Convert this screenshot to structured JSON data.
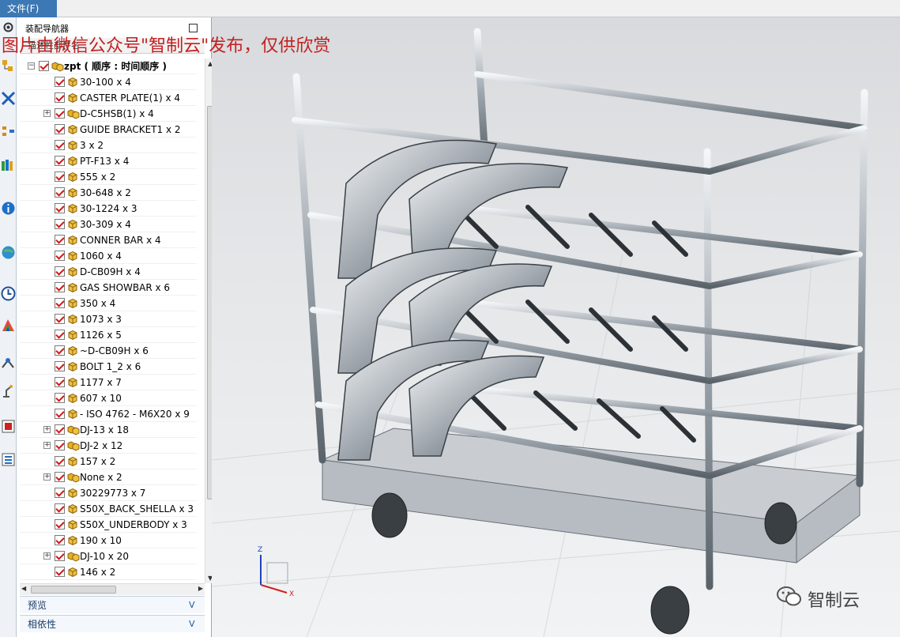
{
  "menubar": {
    "file_menu": "文件(F)"
  },
  "watermark": {
    "text": "图片由微信公众号\"智制云\"发布，仅供欣赏"
  },
  "navigator": {
    "title": "装配导航器",
    "column_header": "描述性部件名",
    "root": {
      "label": "zpt ( 顺序 : 时间顺序 )"
    },
    "items": [
      {
        "label": "30-100 x 4",
        "expandable": false
      },
      {
        "label": "CASTER PLATE(1) x 4",
        "expandable": false
      },
      {
        "label": "D-C5HSB(1) x 4",
        "expandable": true
      },
      {
        "label": "GUIDE BRACKET1 x 2",
        "expandable": false
      },
      {
        "label": "3 x 2",
        "expandable": false
      },
      {
        "label": "PT-F13 x 4",
        "expandable": false
      },
      {
        "label": "555 x 2",
        "expandable": false
      },
      {
        "label": "30-648 x 2",
        "expandable": false
      },
      {
        "label": "30-1224 x 3",
        "expandable": false
      },
      {
        "label": "30-309 x 4",
        "expandable": false
      },
      {
        "label": "CONNER BAR x 4",
        "expandable": false
      },
      {
        "label": "1060 x 4",
        "expandable": false
      },
      {
        "label": "D-CB09H x 4",
        "expandable": false
      },
      {
        "label": "GAS SHOWBAR x 6",
        "expandable": false
      },
      {
        "label": "350 x 4",
        "expandable": false
      },
      {
        "label": "1073 x 3",
        "expandable": false
      },
      {
        "label": "1126 x 5",
        "expandable": false
      },
      {
        "label": "~D-CB09H x 6",
        "expandable": false
      },
      {
        "label": "BOLT 1_2 x 6",
        "expandable": false
      },
      {
        "label": "1177 x 7",
        "expandable": false
      },
      {
        "label": "607 x 10",
        "expandable": false
      },
      {
        "label": "- ISO 4762 - M6X20 x 9",
        "expandable": false
      },
      {
        "label": "DJ-13 x 18",
        "expandable": true
      },
      {
        "label": "DJ-2 x 12",
        "expandable": true
      },
      {
        "label": "157 x 2",
        "expandable": false
      },
      {
        "label": "None x 2",
        "expandable": true
      },
      {
        "label": "30229773 x 7",
        "expandable": false
      },
      {
        "label": "S50X_BACK_SHELLA x 3",
        "expandable": false
      },
      {
        "label": "S50X_UNDERBODY x 3",
        "expandable": false
      },
      {
        "label": "190 x 10",
        "expandable": false
      },
      {
        "label": "DJ-10 x 20",
        "expandable": true
      },
      {
        "label": "146 x 2",
        "expandable": false
      }
    ],
    "sections": {
      "preview": "预览",
      "dependencies": "相依性"
    }
  },
  "brand": {
    "label": "智制云"
  },
  "colors": {
    "accent": "#3c78b4",
    "check": "#d01818",
    "watermark": "#c22020"
  }
}
